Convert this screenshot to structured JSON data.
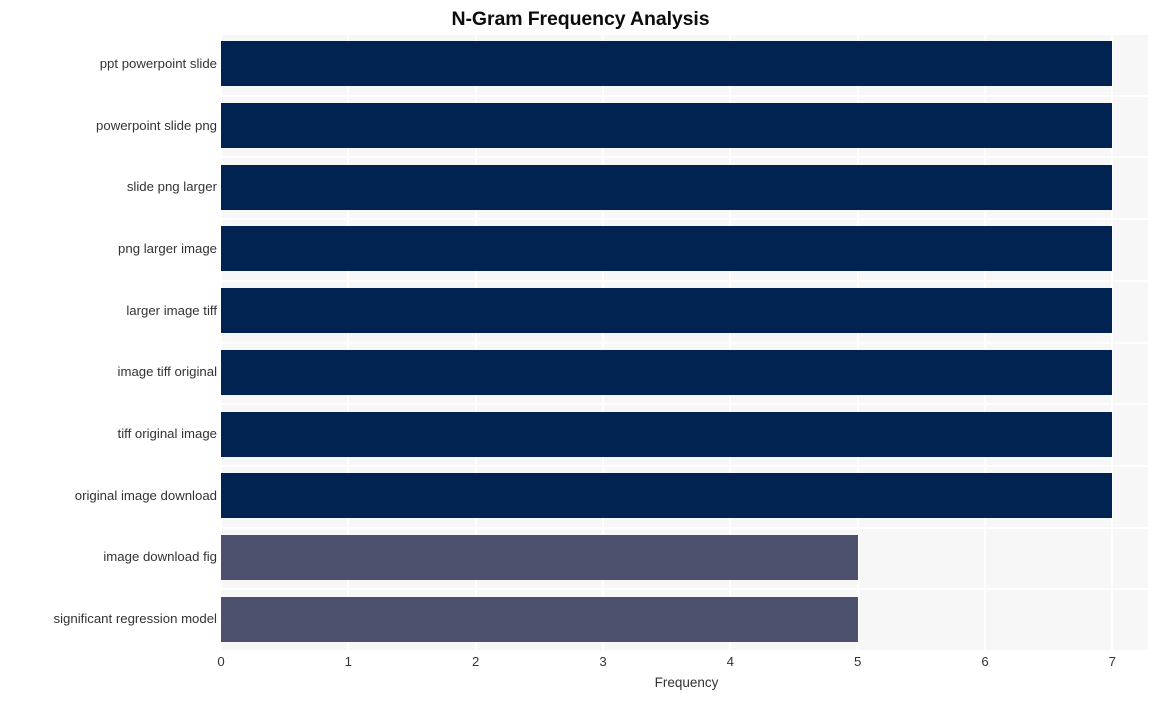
{
  "chart_data": {
    "type": "bar",
    "orientation": "horizontal",
    "title": "N-Gram Frequency Analysis",
    "xlabel": "Frequency",
    "ylabel": "",
    "categories": [
      "ppt powerpoint slide",
      "powerpoint slide png",
      "slide png larger",
      "png larger image",
      "larger image tiff",
      "image tiff original",
      "tiff original image",
      "original image download",
      "image download fig",
      "significant regression model"
    ],
    "values": [
      7,
      7,
      7,
      7,
      7,
      7,
      7,
      7,
      5,
      5
    ],
    "bar_colors": [
      "#012352",
      "#012352",
      "#012352",
      "#012352",
      "#012352",
      "#012352",
      "#012352",
      "#012352",
      "#4d516d",
      "#4d516d"
    ],
    "xlim": [
      0,
      7.28
    ],
    "xticks": [
      "0",
      "1",
      "2",
      "3",
      "4",
      "5",
      "6",
      "7"
    ],
    "xtick_values": [
      0,
      1,
      2,
      3,
      4,
      5,
      6,
      7
    ],
    "grid": true,
    "grid_color": "#ffffff",
    "plot_background": "#f7f7f7",
    "figure_background": "#ffffff",
    "legend": null
  }
}
